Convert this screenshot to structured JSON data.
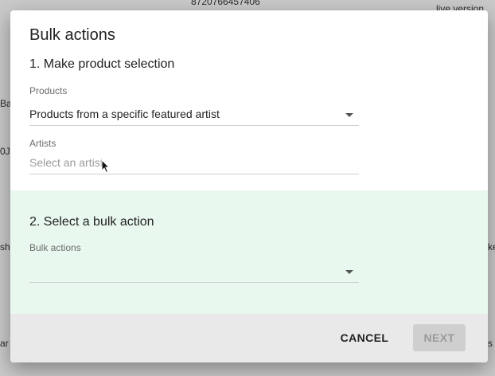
{
  "background": {
    "top_number": "8720766457406",
    "live_version": "live version",
    "left_fragments": [
      "Ba",
      "0J",
      "sh",
      "ar"
    ],
    "right_fragments": [
      "ke",
      "s"
    ]
  },
  "dialog": {
    "title": "Bulk actions",
    "step1": {
      "heading": "1. Make product selection",
      "products_label": "Products",
      "products_value": "Products from a specific featured artist",
      "artists_label": "Artists",
      "artists_placeholder": "Select an artist"
    },
    "step2": {
      "heading": "2. Select a bulk action",
      "bulk_actions_label": "Bulk actions",
      "bulk_actions_value": ""
    },
    "footer": {
      "cancel_label": "CANCEL",
      "next_label": "NEXT"
    }
  },
  "colors": {
    "section_green": "#e9f8ee",
    "footer_gray": "#e9e9e9",
    "disabled_button": "#cfcfcf"
  },
  "icons": [
    "dropdown-caret-icon",
    "mouse-pointer-icon"
  ]
}
